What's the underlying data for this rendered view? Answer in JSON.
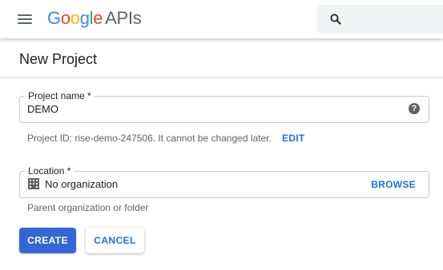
{
  "header": {
    "logo": {
      "letters": [
        "G",
        "o",
        "o",
        "g",
        "l",
        "e"
      ],
      "product": "APIs"
    },
    "icons": {
      "menu": "hamburger-menu-icon",
      "search": "search-icon"
    }
  },
  "page": {
    "title": "New Project"
  },
  "form": {
    "project_name": {
      "label": "Project name *",
      "value": "DEMO",
      "help_glyph": "?"
    },
    "project_id": {
      "text": "Project ID: rise-demo-247506. It cannot be changed later.",
      "edit_label": "EDIT"
    },
    "location": {
      "label": "Location *",
      "value": "No organization",
      "browse_label": "BROWSE",
      "helper": "Parent organization or folder",
      "icon": "building-icon"
    }
  },
  "actions": {
    "create_label": "CREATE",
    "cancel_label": "CANCEL"
  },
  "colors": {
    "accent": "#1a73e8",
    "primary_button": "#3367d6",
    "logo_blue": "#4285f4",
    "logo_red": "#ea4335",
    "logo_yellow": "#fbbc05",
    "logo_green": "#34a853"
  }
}
